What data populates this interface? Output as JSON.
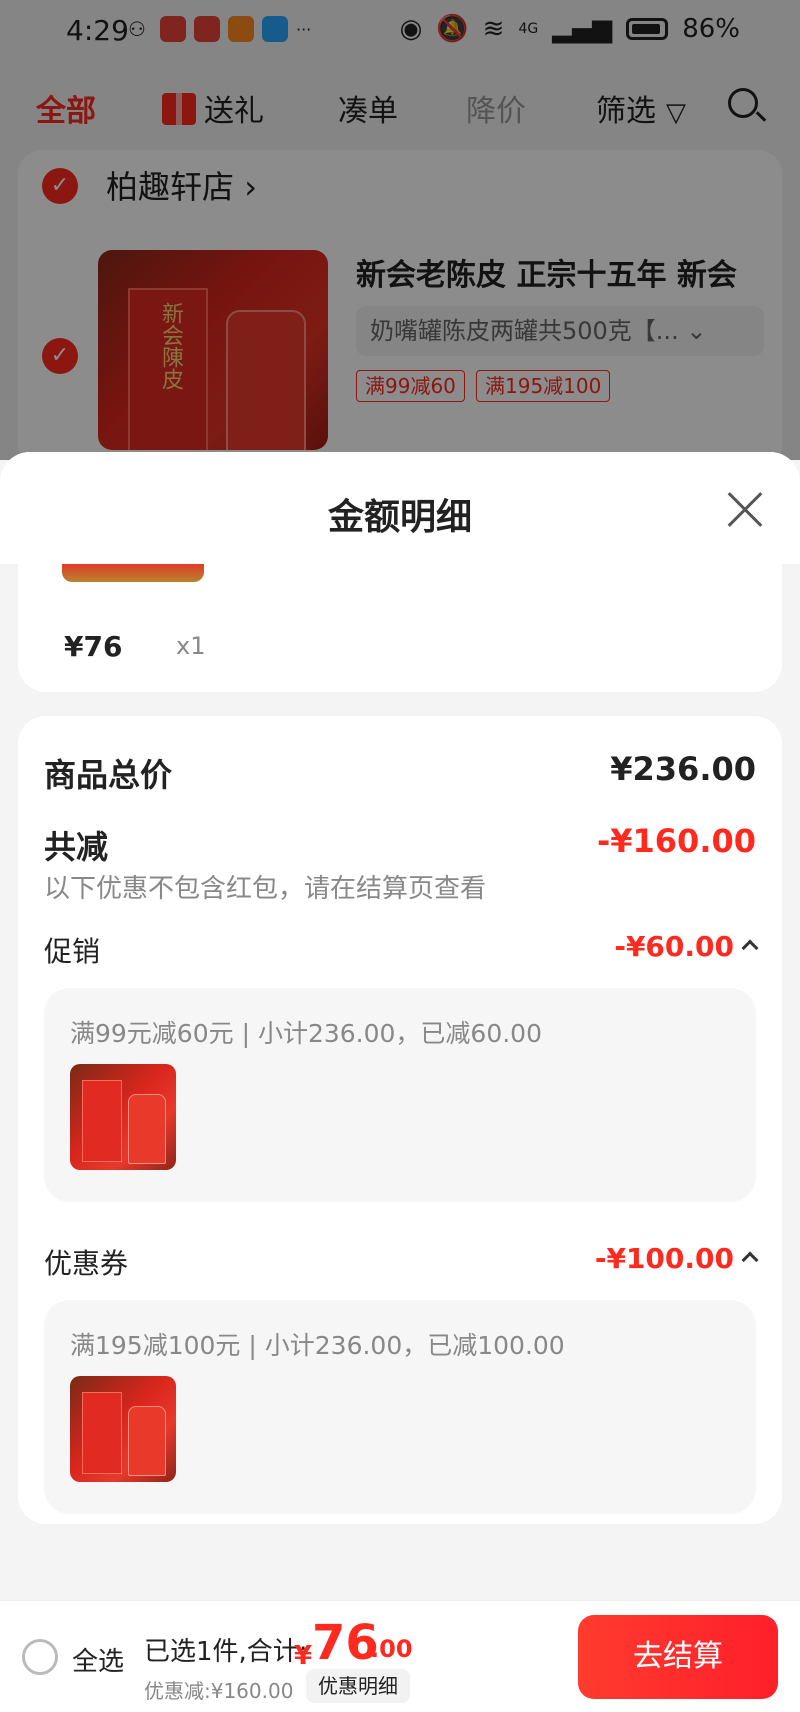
{
  "status_bar": {
    "time": "4:29",
    "battery": "86%",
    "network": "4G",
    "more": "···"
  },
  "top_nav": {
    "tabs": [
      "全部",
      "送礼",
      "凑单",
      "降价",
      "筛选"
    ]
  },
  "cart": {
    "shop_name": "柏趣轩店",
    "product_title": "新会老陈皮 正宗十五年 新会",
    "sku": "奶嘴罐陈皮两罐共500克【...",
    "promo_tags": [
      "满99减60",
      "满195减100"
    ],
    "image_text": "新会陳皮"
  },
  "sheet": {
    "title": "金额明细",
    "item": {
      "price": "¥76",
      "qty": "x1"
    },
    "total_label": "商品总价",
    "total_value": "¥236.00",
    "reduce_label": "共减",
    "reduce_value": "-¥160.00",
    "reduce_note": "以下优惠不包含红包，请在结算页查看",
    "promotion": {
      "label": "促销",
      "value": "-¥60.00",
      "detail": "满99元减60元 | 小计236.00，已减60.00"
    },
    "coupon": {
      "label": "优惠券",
      "value": "-¥100.00",
      "detail": "满195减100元 | 小计236.00，已减100.00"
    }
  },
  "bottom_bar": {
    "select_all": "全选",
    "summary": "已选1件,合计:",
    "currency": "¥",
    "total_int": "76",
    "total_dec": ".00",
    "discount": "优惠减:¥160.00",
    "discount_detail": "优惠明细",
    "checkout": "去结算"
  },
  "colors": {
    "accent": "#ff2a1f",
    "text": "#222222",
    "muted": "#888888"
  }
}
